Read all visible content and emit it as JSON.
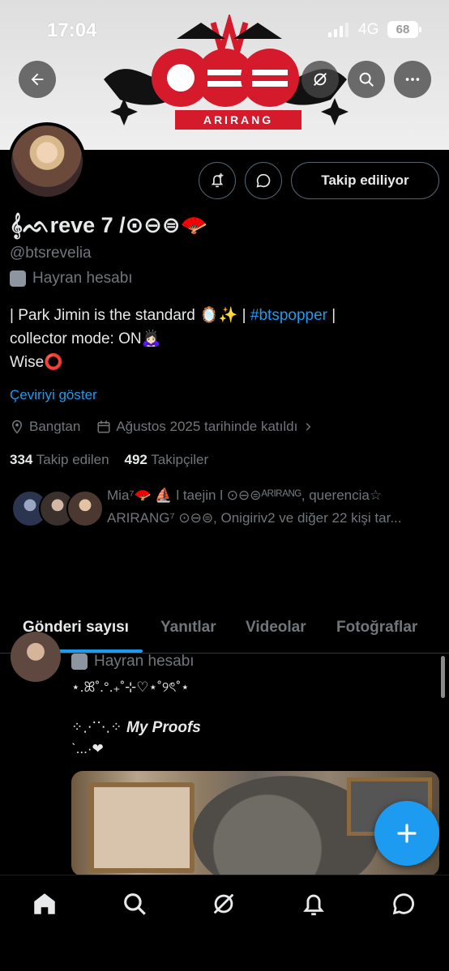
{
  "status_bar": {
    "time": "17:04",
    "network": "4G",
    "battery": "68"
  },
  "banner": {
    "text": "ARIRANG"
  },
  "profile": {
    "display_name": "𝄞ᨒreve 7 /⊙⊖⊜🪭",
    "handle": "@btsrevelia",
    "account_label": "Hayran hesabı",
    "follow_button": "Takip ediliyor",
    "bio_line1_prefix": "| Park Jimin is the standard 🪞✨ | ",
    "bio_hashtag": "#btspopper",
    "bio_line1_suffix": " |",
    "bio_line2": "collector mode: ON🙇🏻‍♀️",
    "bio_line3": "Wise⭕",
    "translate_link": "Çeviriyi göster",
    "location": "Bangtan",
    "joined": "Ağustos 2025 tarihinde katıldı",
    "following_count": "334",
    "following_label": "Takip edilen",
    "followers_count": "492",
    "followers_label": "Takipçiler",
    "followed_by_line1": "Mia⁷🪭 ⛵ l taejin l ⊙⊖⊜ᴬᴿᴵᴿᴬᴺᴳ, querencia☆",
    "followed_by_line2": "ARIRANG⁷ ⊙⊖⊜, Onigiriv2 ve diğer 22 kişi tar..."
  },
  "tabs": [
    "Gönderi sayısı",
    "Yanıtlar",
    "Videolar",
    "Fotoğraflar"
  ],
  "post": {
    "label": "Hayran hesabı",
    "line1": "⋆.ꕤ˚.°.₊˚⊹♡⋆˚୨ৎ˚⋆",
    "line2": "⁘⋰⋱⁘",
    "line3": "ˋ...·❤",
    "proofs": "My Proofs"
  },
  "colors": {
    "accent": "#1d9bf0",
    "banner_red": "#d51a2c",
    "muted": "#71767b"
  },
  "icons": [
    "back-arrow-icon",
    "no-signal-icon",
    "search-icon",
    "more-icon",
    "bell-plus-icon",
    "message-icon",
    "mask-icon",
    "location-icon",
    "calendar-icon",
    "chevron-right-icon",
    "plus-icon",
    "home-icon",
    "grok-icon",
    "notifications-icon",
    "messages-icon"
  ]
}
